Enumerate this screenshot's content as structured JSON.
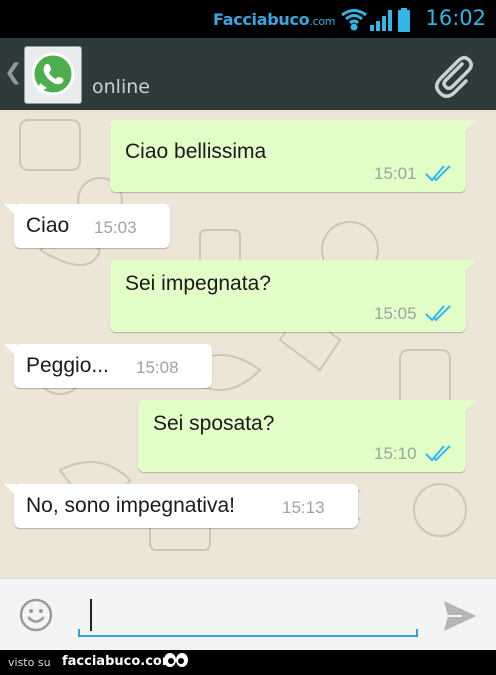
{
  "status_bar": {
    "watermark_brand": "Facciabuco",
    "watermark_tld": ".com",
    "time": "16:02",
    "icons": [
      "wifi-icon",
      "signal-icon",
      "battery-icon"
    ]
  },
  "action_bar": {
    "contact_status": "online",
    "icons": [
      "back-icon",
      "whatsapp-avatar",
      "attach-icon"
    ]
  },
  "messages": [
    {
      "direction": "outgoing",
      "text": "Ciao bellissima",
      "time": "15:01",
      "read": true
    },
    {
      "direction": "incoming",
      "text": "Ciao",
      "time": "15:03"
    },
    {
      "direction": "outgoing",
      "text": "Sei impegnata?",
      "time": "15:05",
      "read": true
    },
    {
      "direction": "incoming",
      "text": "Peggio...",
      "time": "15:08"
    },
    {
      "direction": "outgoing",
      "text": "Sei sposata?",
      "time": "15:10",
      "read": true
    },
    {
      "direction": "incoming",
      "text": "No, sono impegnativa!",
      "time": "15:13"
    }
  ],
  "input_bar": {
    "value": "",
    "icons": [
      "emoji-icon",
      "send-icon"
    ]
  },
  "footer": {
    "prefix": "visto su",
    "site": "facciabuco.com"
  },
  "colors": {
    "outgoing_bubble": "#e2ffc7",
    "incoming_bubble": "#ffffff",
    "read_ticks": "#34b7f1",
    "action_bar": "#2f3a3b",
    "accent": "#33b5e5"
  }
}
